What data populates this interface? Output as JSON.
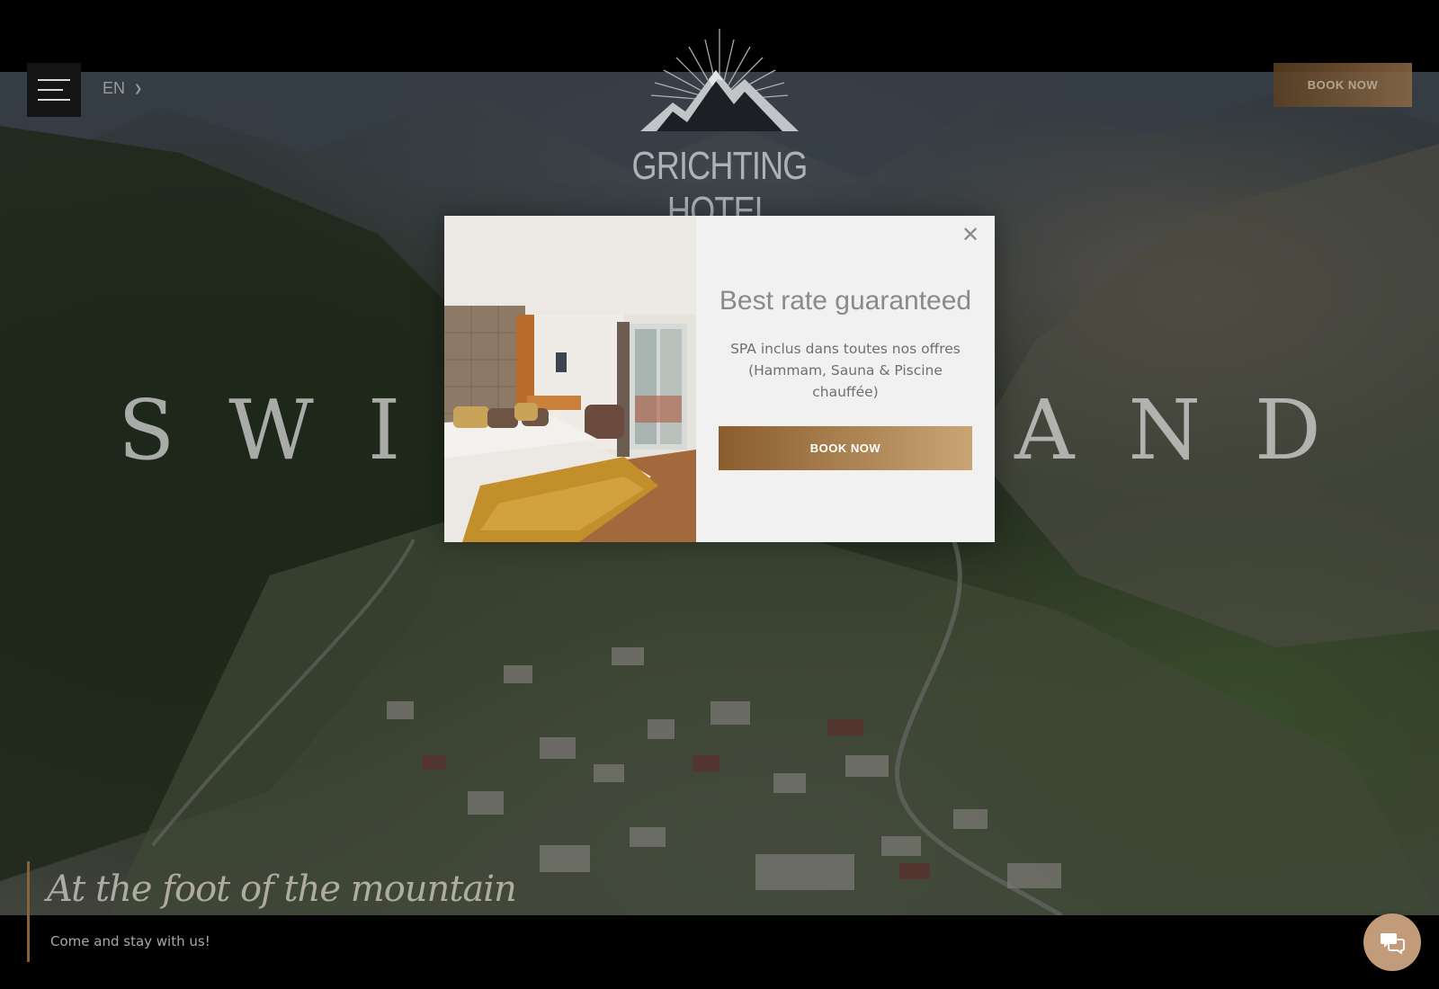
{
  "header": {
    "menu_icon": "hamburger-menu-icon",
    "language": "EN",
    "language_icon": "chevron-down-icon",
    "book_now_label": "BOOK NOW",
    "logo_name": "GRICHTING HOTEL",
    "logo_icon": "mountain-sunburst-logo"
  },
  "hero": {
    "title": "SWITZERLAND"
  },
  "modal": {
    "heading": "Best rate guaranteed",
    "text": "SPA inclus dans toutes nos offres (Hammam, Sauna & Piscine chauffée)",
    "book_now_label": "BOOK NOW",
    "close_icon": "close-icon"
  },
  "footer": {
    "tagline": "At the foot of the mountain",
    "subtitle": "Come and stay with us!",
    "chat_icon": "chat-bubbles-icon"
  },
  "colors": {
    "accent_dark": "#8a5d2d",
    "accent_light": "#c9a575",
    "chat_button": "#c29b7a",
    "modal_background": "#f1f1f1"
  }
}
